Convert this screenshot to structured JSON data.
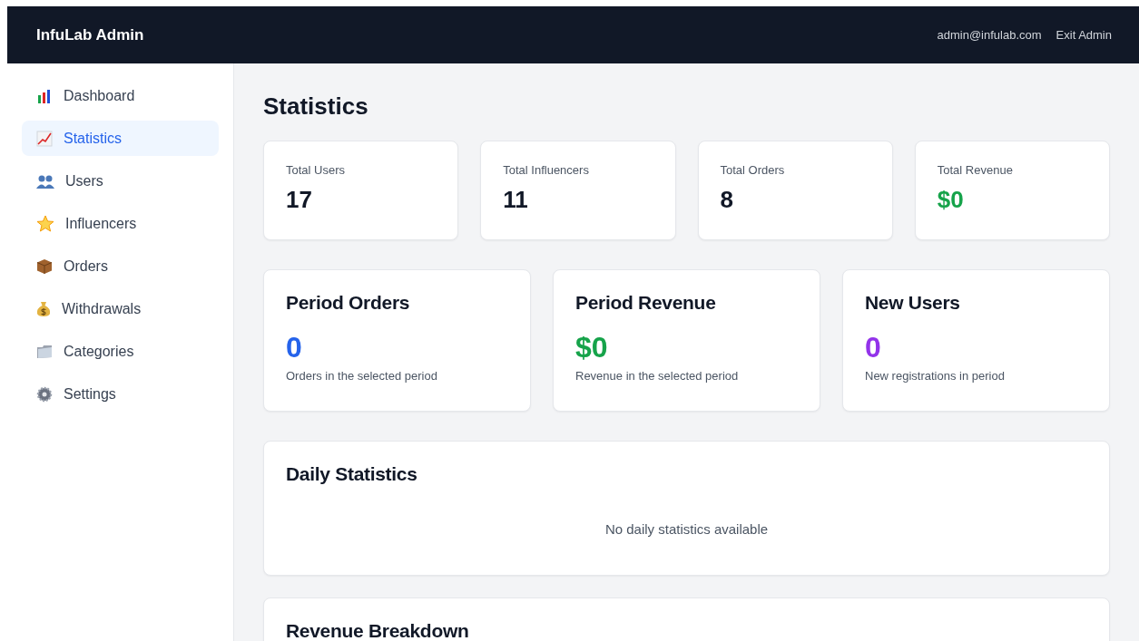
{
  "header": {
    "title": "InfuLab Admin",
    "user_email": "admin@infulab.com",
    "exit_link": "Exit Admin"
  },
  "sidebar": {
    "items": [
      {
        "label": "Dashboard",
        "selected": false
      },
      {
        "label": "Statistics",
        "selected": true
      },
      {
        "label": "Users",
        "selected": false
      },
      {
        "label": "Influencers",
        "selected": false
      },
      {
        "label": "Orders",
        "selected": false
      },
      {
        "label": "Withdrawals",
        "selected": false
      },
      {
        "label": "Categories",
        "selected": false
      },
      {
        "label": "Settings",
        "selected": false
      }
    ]
  },
  "page_title": "Statistics",
  "totals": [
    {
      "label": "Total Users",
      "value": "17",
      "color": "#111827"
    },
    {
      "label": "Total Influencers",
      "value": "11",
      "color": "#111827"
    },
    {
      "label": "Total Orders",
      "value": "8",
      "color": "#111827"
    },
    {
      "label": "Total Revenue",
      "value": "$0",
      "color": "#16a34a"
    }
  ],
  "period_cards": [
    {
      "title": "Period Orders",
      "value": "0",
      "caption": "Orders in the selected period",
      "color": "#2563eb"
    },
    {
      "title": "Period Revenue",
      "value": "$0",
      "caption": "Revenue in the selected period",
      "color": "#16a34a"
    },
    {
      "title": "New Users",
      "value": "0",
      "caption": "New registrations in period",
      "color": "#9333ea"
    }
  ],
  "daily_statistics": {
    "title": "Daily Statistics",
    "empty_message": "No daily statistics available"
  },
  "revenue_breakdown": {
    "title": "Revenue Breakdown"
  }
}
